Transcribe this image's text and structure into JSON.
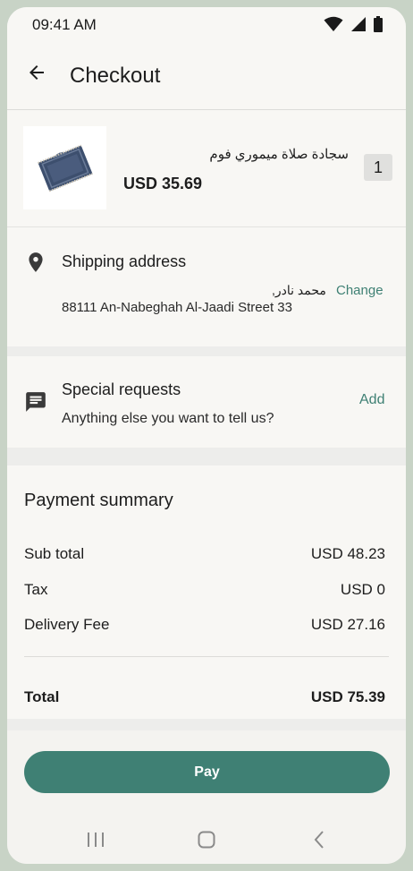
{
  "status_bar": {
    "time": "09:41 AM",
    "icons": [
      "wifi-icon",
      "signal-icon",
      "battery-icon"
    ]
  },
  "app_bar": {
    "title": "Checkout",
    "back_icon": "arrow-left-icon"
  },
  "product": {
    "name": "سجادة صلاة ميموري فوم",
    "price": "USD 35.69",
    "quantity": "1",
    "thumbnail": "prayer-rug-image"
  },
  "shipping": {
    "label": "Shipping address",
    "recipient": "محمد نادر,",
    "change_label": "Change",
    "address": "88111 An-Nabeghah Al-Jaadi Street 33"
  },
  "special_requests": {
    "label": "Special requests",
    "placeholder": "Anything else you want to tell us?",
    "add_label": "Add"
  },
  "payment_summary": {
    "heading": "Payment summary",
    "rows": [
      {
        "label": "Sub total",
        "value": "USD 48.23"
      },
      {
        "label": "Tax",
        "value": "USD 0"
      },
      {
        "label": "Delivery Fee",
        "value": "USD 27.16"
      }
    ],
    "total": {
      "label": "Total",
      "value": "USD 75.39"
    }
  },
  "pay_button": {
    "label": "Pay"
  },
  "colors": {
    "accent": "#3f8074",
    "background": "#ededeb",
    "card": "#f8f7f4"
  }
}
